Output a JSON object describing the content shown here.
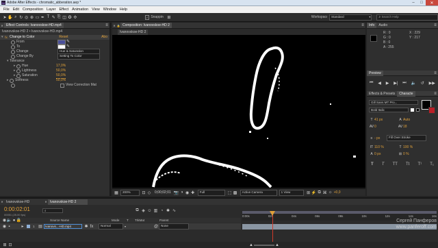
{
  "window": {
    "title": "Adobe After Effects - chromatic_abberation.aep *"
  },
  "menu": [
    "File",
    "Edit",
    "Composition",
    "Layer",
    "Effect",
    "Animation",
    "View",
    "Window",
    "Help"
  ],
  "toolbar": {
    "snapping_label": "Snapping",
    "workspace_label": "Workspace:",
    "workspace_value": "Standard",
    "search_placeholder": "Search Help"
  },
  "effect_controls": {
    "tab_label": "Effect Controls: Ivanovskoe-HD.mp4",
    "breadcrumb": "Ivanovskoe-HD 2 • Ivanovskoe-HD.mp4",
    "effect_name": "Change to Color",
    "reset_label": "Reset",
    "about_label": "Abo",
    "props": [
      {
        "label": "From",
        "type": "color",
        "color": "#4a4f9a"
      },
      {
        "label": "To",
        "type": "color",
        "color": "#ffffff"
      },
      {
        "label": "Change",
        "type": "select",
        "value": "Hue & Saturation"
      },
      {
        "label": "Change By",
        "type": "select",
        "value": "Setting To Color"
      },
      {
        "label": "Tolerance",
        "type": "group"
      },
      {
        "label": "Hue",
        "type": "value",
        "value": "17,0%"
      },
      {
        "label": "Lightness",
        "type": "value",
        "value": "50,0%"
      },
      {
        "label": "Saturation",
        "type": "value",
        "value": "50,0%"
      },
      {
        "label": "Softness",
        "type": "value",
        "value": "50,0%"
      },
      {
        "label": "View Correction Mat",
        "type": "check"
      }
    ]
  },
  "composition": {
    "tab_label": "Composition: Ivanovskoe-HD 2",
    "sub_tab": "Ivanovskoe-HD 2",
    "footer": {
      "zoom": "200%",
      "time": "0;00;02;01",
      "resolution": "Full",
      "camera": "Active Camera",
      "views": "1 View",
      "exposure": "+0,0"
    }
  },
  "info": {
    "tabs": [
      "Info",
      "Audio"
    ],
    "r": "R : 0",
    "g": "G : 0",
    "b": "B : 0",
    "a": "A : 255",
    "x": "X : 229",
    "y": "Y : 217"
  },
  "preview": {
    "tab": "Preview"
  },
  "character": {
    "tabs": [
      "Effects & Presets",
      "Characte"
    ],
    "font": "Gill Sans MT Pro...",
    "style": "Bold Italic",
    "size": "41 px",
    "leading": "Auto",
    "kerning": "0",
    "tracking": "18",
    "stroke_width": "- px",
    "stroke_type": "Fill Over Stroke",
    "vscale": "110 %",
    "hscale": "100 %",
    "baseline": "0 px",
    "tsume": "0 %",
    "type_buttons": [
      "T",
      "T",
      "TT",
      "Tt",
      "T¹",
      "T₁"
    ]
  },
  "timeline": {
    "tabs": [
      "Ivanovskoe-HD",
      "Ivanovskoe-HD 2"
    ],
    "current_time": "0:00:02:01",
    "frame_info": "00051 (25.00 fps)",
    "columns": {
      "source": "Source Name",
      "mode": "Mode",
      "t": "T",
      "trkmat": "TrkMat",
      "parent": "Parent"
    },
    "layer": {
      "number": "1",
      "name": "Ivanovs...-HD.mp4",
      "mode": "Normal",
      "parent": "None"
    },
    "ruler": [
      "0:00s",
      "02s",
      "04s",
      "06s",
      "08s",
      "10s",
      "12s",
      "14s",
      "16s"
    ]
  },
  "watermark": {
    "line1": "Сергей Панферов",
    "line2": "www.panferoff.com"
  },
  "colors": {
    "accent": "#e0a13a",
    "blue": "#4f8fd6",
    "playhead": "#d23a2a"
  }
}
